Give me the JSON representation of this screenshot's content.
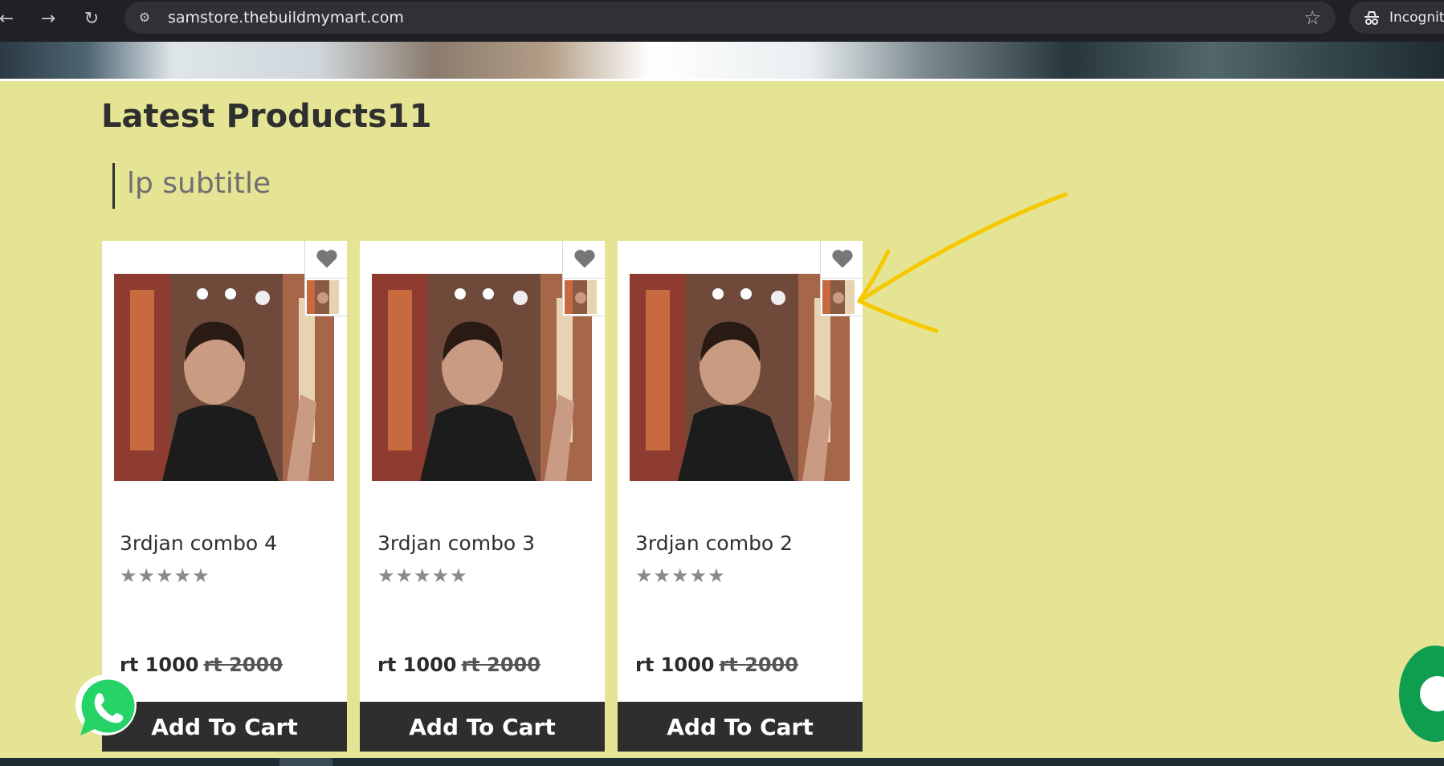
{
  "browser": {
    "url": "samstore.thebuildmymart.com",
    "incognito_label": "Incognit",
    "icons": {
      "back": "back-arrow-icon",
      "forward": "forward-arrow-icon",
      "reload": "reload-icon",
      "site_info": "site-settings-icon",
      "bookmark": "star-icon",
      "incognito": "incognito-icon"
    }
  },
  "section": {
    "title": "Latest Products11",
    "subtitle": "lp subtitle"
  },
  "products": [
    {
      "name": "3rdjan combo 4",
      "rating": "★★★★★",
      "price": "rt 1000",
      "old_price": "rt 2000",
      "cta": "Add To Cart"
    },
    {
      "name": "3rdjan combo 3",
      "rating": "★★★★★",
      "price": "rt 1000",
      "old_price": "rt 2000",
      "cta": "Add To Cart"
    },
    {
      "name": "3rdjan combo 2",
      "rating": "★★★★★",
      "price": "rt 1000",
      "old_price": "rt 2000",
      "cta": "Add To Cart"
    }
  ],
  "colors": {
    "page_background": "#e5e495",
    "card_background": "#ffffff",
    "cta_background": "#2e2e2e",
    "annotation_arrow": "#f5c800",
    "whatsapp_green": "#25d366",
    "chat_green": "#0f9d4f"
  }
}
